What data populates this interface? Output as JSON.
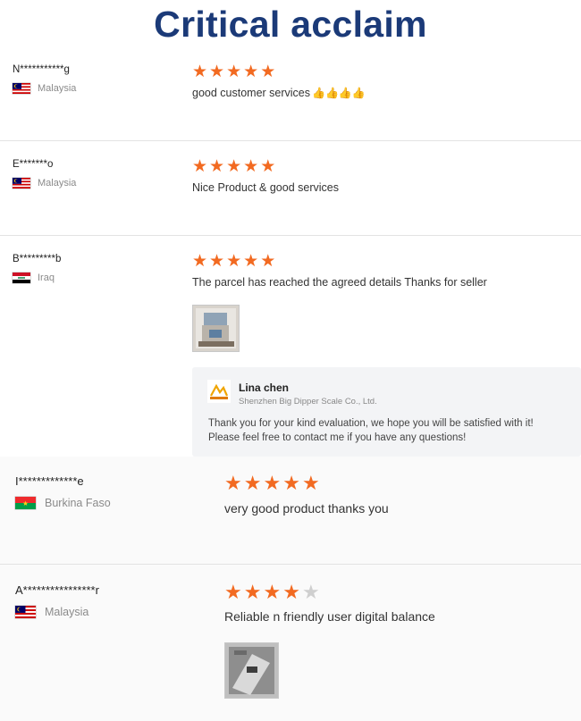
{
  "page": {
    "title": "Critical acclaim"
  },
  "reviews": [
    {
      "name": "N***********g",
      "country": "Malaysia",
      "flag": "malaysia-flag-icon",
      "rating": 5,
      "text": "good customer services",
      "emoji": "👍👍👍👍"
    },
    {
      "name": "E*******o",
      "country": "Malaysia",
      "flag": "malaysia-flag-icon",
      "rating": 5,
      "text": "Nice Product & good services"
    },
    {
      "name": "B*********b",
      "country": "Iraq",
      "flag": "iraq-flag-icon",
      "rating": 5,
      "text": "The parcel has reached the agreed details Thanks for seller",
      "reply": {
        "name": "Lina chen",
        "company": "Shenzhen Big Dipper Scale Co., Ltd.",
        "text_line1": "Thank you for your kind evaluation, we hope you will be satisfied with it!",
        "text_line2": "Please feel free to contact me if you have any questions!"
      }
    },
    {
      "name": "I*************e",
      "country": "Burkina Faso",
      "flag": "burkina-faso-flag-icon",
      "rating": 5,
      "text": "very good product thanks you"
    },
    {
      "name": "A****************r",
      "country": "Malaysia",
      "flag": "malaysia-flag-icon",
      "rating": 4,
      "text": "Reliable n friendly user digital balance"
    }
  ],
  "colors": {
    "title": "#1b3a78",
    "star_on": "#f26a21",
    "star_off": "#cfcfcf"
  }
}
